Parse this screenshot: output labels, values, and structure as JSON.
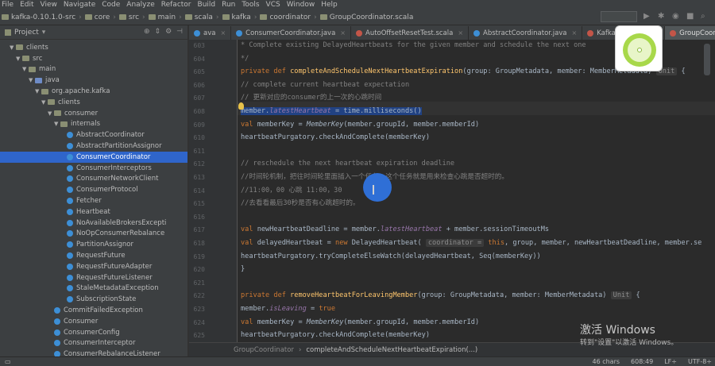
{
  "menu": [
    "File",
    "Edit",
    "View",
    "Navigate",
    "Code",
    "Analyze",
    "Refactor",
    "Build",
    "Run",
    "Tools",
    "VCS",
    "Window",
    "Help"
  ],
  "breadcrumbs": [
    "kafka-0.10.1.0-src",
    "core",
    "src",
    "main",
    "scala",
    "kafka",
    "coordinator",
    "GroupCoordinator.scala"
  ],
  "project_panel": {
    "title": "Project"
  },
  "tree": [
    {
      "label": "clients",
      "indent": 1,
      "icon": "folder",
      "arrow": "▼"
    },
    {
      "label": "src",
      "indent": 2,
      "icon": "folder",
      "arrow": "▼"
    },
    {
      "label": "main",
      "indent": 3,
      "icon": "folder",
      "arrow": "▼"
    },
    {
      "label": "java",
      "indent": 4,
      "icon": "src",
      "arrow": "▼"
    },
    {
      "label": "org.apache.kafka",
      "indent": 5,
      "icon": "folder",
      "arrow": "▼"
    },
    {
      "label": "clients",
      "indent": 6,
      "icon": "folder",
      "arrow": "▼"
    },
    {
      "label": "consumer",
      "indent": 7,
      "icon": "folder",
      "arrow": "▼"
    },
    {
      "label": "internals",
      "indent": 8,
      "icon": "folder",
      "arrow": "▼"
    },
    {
      "label": "AbstractCoordinator",
      "indent": 9,
      "icon": "class"
    },
    {
      "label": "AbstractPartitionAssignor",
      "indent": 9,
      "icon": "class"
    },
    {
      "label": "ConsumerCoordinator",
      "indent": 9,
      "icon": "class",
      "selected": true
    },
    {
      "label": "ConsumerInterceptors",
      "indent": 9,
      "icon": "class"
    },
    {
      "label": "ConsumerNetworkClient",
      "indent": 9,
      "icon": "class"
    },
    {
      "label": "ConsumerProtocol",
      "indent": 9,
      "icon": "class"
    },
    {
      "label": "Fetcher",
      "indent": 9,
      "icon": "class"
    },
    {
      "label": "Heartbeat",
      "indent": 9,
      "icon": "class"
    },
    {
      "label": "NoAvailableBrokersExcepti",
      "indent": 9,
      "icon": "class"
    },
    {
      "label": "NoOpConsumerRebalance",
      "indent": 9,
      "icon": "class"
    },
    {
      "label": "PartitionAssignor",
      "indent": 9,
      "icon": "class"
    },
    {
      "label": "RequestFuture",
      "indent": 9,
      "icon": "class"
    },
    {
      "label": "RequestFutureAdapter",
      "indent": 9,
      "icon": "class"
    },
    {
      "label": "RequestFutureListener",
      "indent": 9,
      "icon": "class"
    },
    {
      "label": "StaleMetadataException",
      "indent": 9,
      "icon": "class"
    },
    {
      "label": "SubscriptionState",
      "indent": 9,
      "icon": "class"
    },
    {
      "label": "CommitFailedException",
      "indent": 7,
      "icon": "class"
    },
    {
      "label": "Consumer",
      "indent": 7,
      "icon": "class"
    },
    {
      "label": "ConsumerConfig",
      "indent": 7,
      "icon": "class"
    },
    {
      "label": "ConsumerInterceptor",
      "indent": 7,
      "icon": "class"
    },
    {
      "label": "ConsumerRebalanceListener",
      "indent": 7,
      "icon": "class"
    }
  ],
  "tabs": [
    {
      "label": "ava",
      "icon": "java"
    },
    {
      "label": "ConsumerCoordinator.java",
      "icon": "java"
    },
    {
      "label": "AutoOffsetResetTest.scala",
      "icon": "scala"
    },
    {
      "label": "AbstractCoordinator.java",
      "icon": "java"
    },
    {
      "label": "KafkaApis.scala",
      "icon": "scala"
    },
    {
      "label": "GroupCoordinator.scala",
      "icon": "scala",
      "active": true
    }
  ],
  "line_numbers": [
    "603",
    "604",
    "605",
    "606",
    "607",
    "608",
    "609",
    "610",
    "611",
    "612",
    "613",
    "614",
    "615",
    "616",
    "617",
    "618",
    "619",
    "620",
    "621",
    "622",
    "623",
    "624",
    "625"
  ],
  "code_lines": [
    [
      [
        "cm",
        "   * Complete existing DelayedHeartbeats for the given member and schedule the next one"
      ]
    ],
    [
      [
        "cm",
        "   */"
      ]
    ],
    [
      [
        "kw",
        "  private def "
      ],
      [
        "fn",
        "completeAndScheduleNextHeartbeatExpiration"
      ],
      [
        "",
        "(group: GroupMetadata, member: MemberMetadata) "
      ],
      [
        "hint",
        "Unit"
      ],
      [
        "",
        " {"
      ]
    ],
    [
      [
        "cm",
        "    // complete current heartbeat expectation"
      ]
    ],
    [
      [
        "cm",
        "    // 更新对应的consumer的上一次的心跳时间"
      ]
    ],
    [
      [
        "selt",
        "    member."
      ],
      [
        "selit",
        "latestHeartbeat"
      ],
      [
        "selt",
        " = time.milliseconds()"
      ]
    ],
    [
      [
        "kw",
        "    val "
      ],
      [
        "",
        "memberKey = "
      ],
      [
        "ity",
        "MemberKey"
      ],
      [
        "",
        "(member.groupId, member.memberId)"
      ]
    ],
    [
      [
        "",
        "    heartbeatPurgatory.checkAndComplete(memberKey)"
      ]
    ],
    [
      [
        "",
        ""
      ]
    ],
    [
      [
        "cm",
        "    // reschedule the next heartbeat expiration deadline"
      ]
    ],
    [
      [
        "cm",
        "    //时间轮机制，把往时间轮里面插入一个任务，这个任务就是用来检查心跳是否超时的。"
      ]
    ],
    [
      [
        "cm",
        "    //11:00，00 心跳  11:00，30"
      ]
    ],
    [
      [
        "cm",
        "    //去看看最后30秒是否有心跳超时的。"
      ]
    ],
    [
      [
        "",
        ""
      ]
    ],
    [
      [
        "kw",
        "    val "
      ],
      [
        "",
        "newHeartbeatDeadline = member."
      ],
      [
        "it",
        "latestHeartbeat"
      ],
      [
        "",
        " + member.sessionTimeoutMs"
      ]
    ],
    [
      [
        "kw",
        "    val "
      ],
      [
        "",
        "delayedHeartbeat = "
      ],
      [
        "kw",
        "new "
      ],
      [
        "",
        "DelayedHeartbeat( "
      ],
      [
        "hint",
        "coordinator ="
      ],
      [
        "kw",
        " this"
      ],
      [
        "",
        ", group, member, newHeartbeatDeadline, member.se"
      ]
    ],
    [
      [
        "",
        "    heartbeatPurgatory.tryCompleteElseWatch(delayedHeartbeat, Seq(memberKey))"
      ]
    ],
    [
      [
        "",
        "  }"
      ]
    ],
    [
      [
        "",
        ""
      ]
    ],
    [
      [
        "kw",
        "  private def "
      ],
      [
        "fn",
        "removeHeartbeatForLeavingMember"
      ],
      [
        "",
        "(group: GroupMetadata, member: MemberMetadata) "
      ],
      [
        "hint",
        "Unit"
      ],
      [
        "",
        " {"
      ]
    ],
    [
      [
        "",
        "    member."
      ],
      [
        "it",
        "isLeaving"
      ],
      [
        "",
        " = "
      ],
      [
        "kw",
        "true"
      ]
    ],
    [
      [
        "kw",
        "    val "
      ],
      [
        "",
        "memberKey = "
      ],
      [
        "ity",
        "MemberKey"
      ],
      [
        "",
        "(member.groupId, member.memberId)"
      ]
    ],
    [
      [
        "",
        "    heartbeatPurgatory.checkAndComplete(memberKey)"
      ]
    ]
  ],
  "editor_breadcrumb": {
    "class": "GroupCoordinator",
    "method": "completeAndScheduleNextHeartbeatExpiration(...)"
  },
  "status": {
    "chars": "46 chars",
    "position": "608:49",
    "line_sep": "LF÷",
    "encoding": "UTF-8÷"
  },
  "watermark": {
    "title": "激活 Windows",
    "sub": "转到\"设置\"以激活 Windows。"
  },
  "colors": {
    "keyword": "#cc7832",
    "function": "#ffc66d",
    "comment": "#808080",
    "field": "#9876aa",
    "selection": "#214283",
    "tree_selection": "#2f65ca"
  }
}
